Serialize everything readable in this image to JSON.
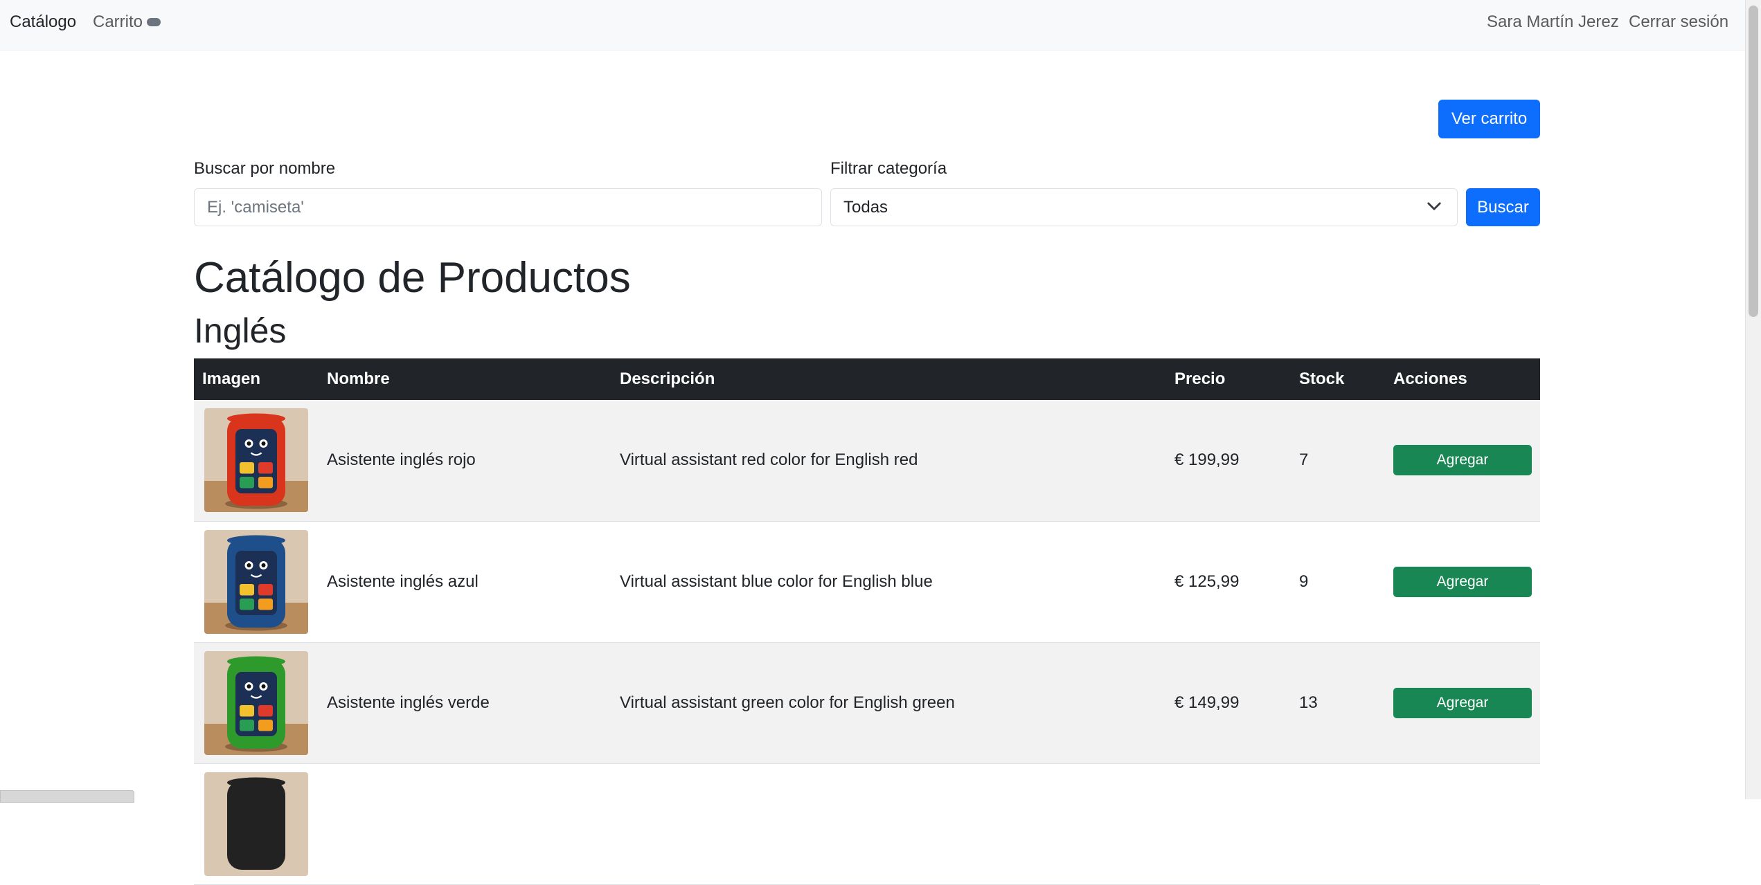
{
  "navbar": {
    "brand": "Catálogo",
    "cart_link": "Carrito",
    "user_name": "Sara Martín Jerez",
    "logout": "Cerrar sesión"
  },
  "actions": {
    "view_cart": "Ver carrito"
  },
  "search": {
    "name_label": "Buscar por nombre",
    "name_placeholder": "Ej. 'camiseta'",
    "category_label": "Filtrar categoría",
    "category_value": "Todas",
    "submit": "Buscar"
  },
  "page": {
    "title": "Catálogo de Productos",
    "category_heading": "Inglés"
  },
  "table": {
    "headers": [
      "Imagen",
      "Nombre",
      "Descripción",
      "Precio",
      "Stock",
      "Acciones"
    ],
    "rows": [
      {
        "name": "Asistente inglés rojo",
        "description": "Virtual assistant red color for English red",
        "price": "€ 199,99",
        "stock": "7",
        "action": "Agregar",
        "body_color": "#d9341c",
        "image_alt": "Asistente inglés rojo"
      },
      {
        "name": "Asistente inglés azul",
        "description": "Virtual assistant blue color for English blue",
        "price": "€ 125,99",
        "stock": "9",
        "action": "Agregar",
        "body_color": "#1f4f8a",
        "image_alt": "Asistente inglés azul"
      },
      {
        "name": "Asistente inglés verde",
        "description": "Virtual assistant green color for English green",
        "price": "€ 149,99",
        "stock": "13",
        "action": "Agregar",
        "body_color": "#2f9a2c",
        "image_alt": "Asistente inglés verde"
      },
      {
        "name": "",
        "description": "",
        "price": "",
        "stock": "",
        "action": "",
        "body_color": "#222222",
        "image_alt": ""
      }
    ]
  },
  "colors": {
    "primary": "#0d6efd",
    "success": "#198754",
    "table_header": "#212529",
    "navbar_bg": "#f8f9fa"
  }
}
